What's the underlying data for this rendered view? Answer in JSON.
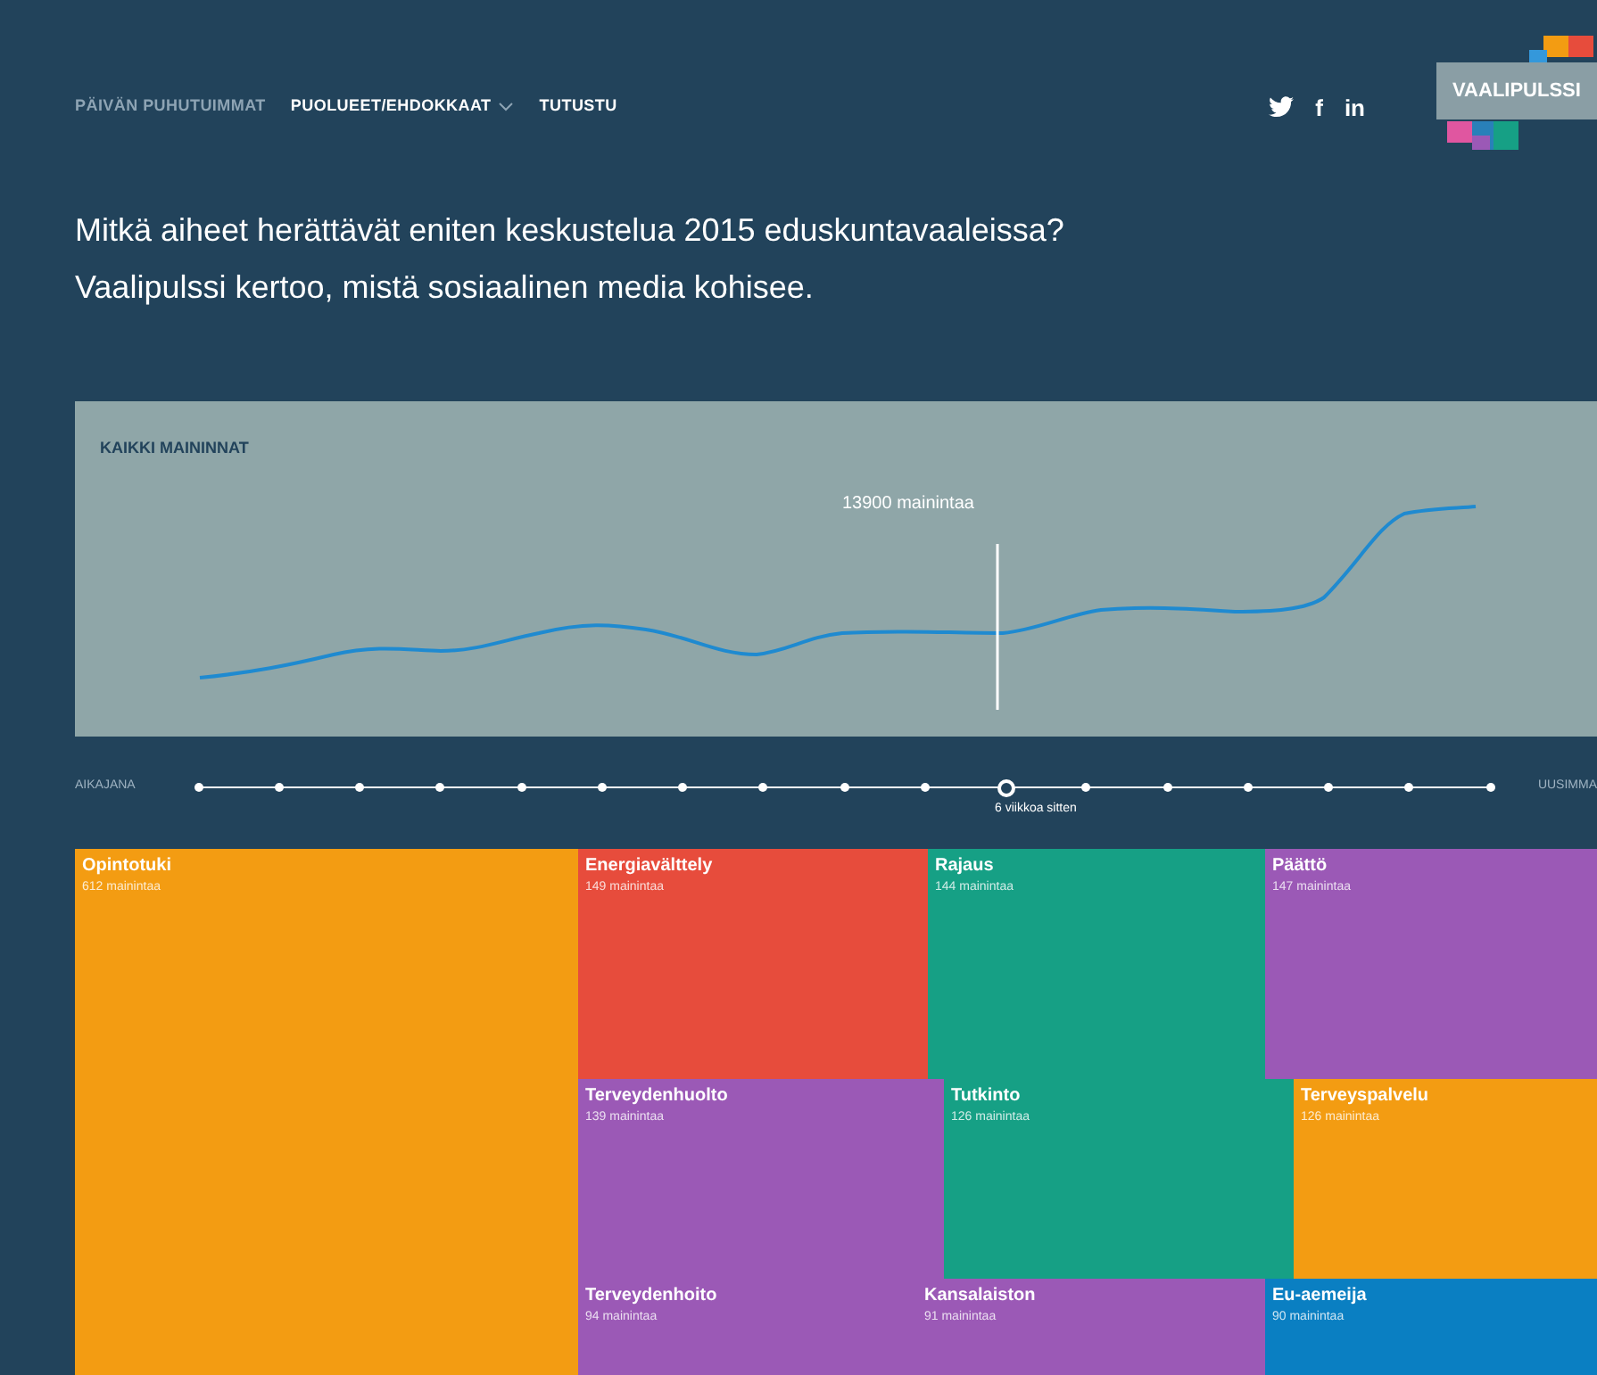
{
  "nav": {
    "items": [
      {
        "label": "PÄIVÄN PUHUTUIMMAT",
        "selected": true,
        "dropdown": false
      },
      {
        "label": "PUOLUEET/EHDOKKAAT",
        "selected": false,
        "dropdown": true
      },
      {
        "label": "TUTUSTU",
        "selected": false,
        "dropdown": false
      }
    ],
    "social": [
      {
        "kind": "bird"
      },
      {
        "kind": "glyph",
        "text": "f"
      },
      {
        "kind": "glyph",
        "text": "in"
      }
    ],
    "logo": "VAALIPULSSI"
  },
  "headline": [
    "Mitkä aiheet herättävät eniten keskustelua 2015 eduskuntavaaleissa?",
    "Vaalipulssi kertoo, mistä sosiaalinen media kohisee."
  ],
  "chart_panel": {
    "title": "KAIKKI MAININNAT",
    "marker_label": "13900 mainintaa"
  },
  "timeline": {
    "start_label": "AIKAJANA",
    "end_label": "UUSIMMA",
    "selected_label": "6 viikkoa sitten",
    "points": [
      {
        "selected": false
      },
      {
        "selected": false
      },
      {
        "selected": false
      },
      {
        "selected": false
      },
      {
        "selected": false
      },
      {
        "selected": false
      },
      {
        "selected": false
      },
      {
        "selected": false
      },
      {
        "selected": false
      },
      {
        "selected": false
      },
      {
        "selected": true
      },
      {
        "selected": false
      },
      {
        "selected": false
      },
      {
        "selected": false
      },
      {
        "selected": false
      },
      {
        "selected": false
      },
      {
        "selected": false
      }
    ]
  },
  "treemap": [
    {
      "name": "Opintotuki",
      "count": "612 mainintaa",
      "color": "#f39c12"
    },
    {
      "name": "Energiavälttely",
      "count": "149 mainintaa",
      "color": "#e74c3c"
    },
    {
      "name": "Rajaus",
      "count": "144 mainintaa",
      "color": "#16a085"
    },
    {
      "name": "Päättö",
      "count": "147 mainintaa",
      "color": "#9b59b6"
    },
    {
      "name": "Terveydenhuolto",
      "count": "139 mainintaa",
      "color": "#9b59b6"
    },
    {
      "name": "Tutkinto",
      "count": "126 mainintaa",
      "color": "#16a085"
    },
    {
      "name": "Terveyspalvelu",
      "count": "126 mainintaa",
      "color": "#f39c12"
    },
    {
      "name": "Terveydenhoito",
      "count": "94 mainintaa",
      "color": "#9b59b6"
    },
    {
      "name": "Kansalaiston",
      "count": "91 mainintaa",
      "color": "#9b59b6"
    },
    {
      "name": "Eu-aemeija",
      "count": "90 mainintaa",
      "color": "#0a7fc2"
    }
  ]
}
